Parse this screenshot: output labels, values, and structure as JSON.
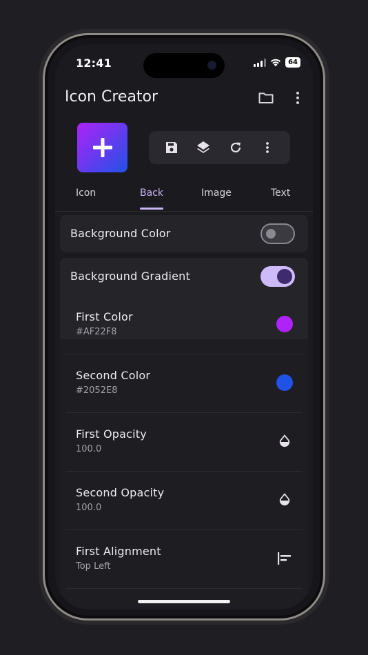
{
  "status": {
    "time": "12:41",
    "battery": "64"
  },
  "app": {
    "title": "Icon Creator"
  },
  "preview": {
    "gradient_start": "#AF22F8",
    "gradient_end": "#2052E8"
  },
  "tabs": [
    {
      "label": "Icon"
    },
    {
      "label": "Back"
    },
    {
      "label": "Image"
    },
    {
      "label": "Text"
    }
  ],
  "active_tab": "Back",
  "settings": {
    "background_color": {
      "label": "Background Color",
      "enabled": false
    },
    "background_gradient": {
      "label": "Background Gradient",
      "enabled": true
    }
  },
  "gradient_rows": [
    {
      "title": "First Color",
      "value": "#AF22F8",
      "icon": "color-dot",
      "color": "#AF22F8"
    },
    {
      "title": "Second Color",
      "value": "#2052E8",
      "icon": "color-dot",
      "color": "#2052E8"
    },
    {
      "title": "First Opacity",
      "value": "100.0",
      "icon": "opacity-drop-icon"
    },
    {
      "title": "Second Opacity",
      "value": "100.0",
      "icon": "opacity-drop-icon"
    },
    {
      "title": "First Alignment",
      "value": "Top Left",
      "icon": "align-left-icon"
    }
  ],
  "colors": {
    "accent": "#C9B6F5",
    "background": "#1B1A1F",
    "card": "#252429"
  }
}
